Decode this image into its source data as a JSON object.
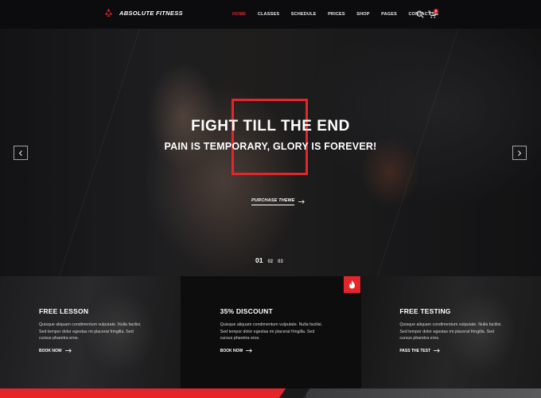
{
  "brand": {
    "name": "ABSOLUTE FITNESS",
    "accent_color": "#e4262b"
  },
  "nav": {
    "items": [
      {
        "label": "HOME",
        "active": true
      },
      {
        "label": "CLASSES",
        "active": false
      },
      {
        "label": "SCHEDULE",
        "active": false
      },
      {
        "label": "PRICES",
        "active": false
      },
      {
        "label": "SHOP",
        "active": false
      },
      {
        "label": "PAGES",
        "active": false
      },
      {
        "label": "CONTACT US",
        "active": false
      }
    ],
    "search_icon": "search-icon",
    "cart_icon": "cart-icon",
    "cart_count": "0"
  },
  "hero": {
    "title": "FIGHT TILL THE END",
    "subtitle": "PAIN IS TEMPORARY, GLORY IS FOREVER!",
    "cta_label": "PURCHASE THEME",
    "slides": [
      "01",
      "02",
      "03"
    ],
    "active_slide": "01"
  },
  "features": [
    {
      "title": "FREE LESSON",
      "text": "Quisque aliquam condimentum vulputate. Nulla facilisi. Sed tempor dolor egestas mi placerat fringilla. Sed cursus pharetra eros.",
      "link_label": "BOOK NOW"
    },
    {
      "title": "35% DISCOUNT",
      "text": "Quisque aliquam condimentum vulputate. Nulla facilisi. Sed tempor dolor egestas mi placerat fringilla. Sed cursus pharetra eros.",
      "link_label": "BOOK NOW"
    },
    {
      "title": "FREE TESTING",
      "text": "Quisque aliquam condimentum vulputate. Nulla facilisi. Sed tempor dolor egestas mi placerat fringilla. Sed cursus pharetra eros.",
      "link_label": "PASS THE TEST"
    }
  ]
}
